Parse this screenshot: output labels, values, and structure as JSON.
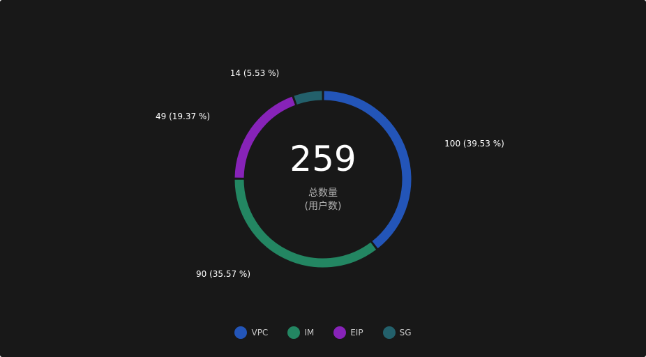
{
  "chart_data": {
    "type": "pie",
    "total": "259",
    "center_label": "总数量",
    "center_sublabel": "(用户数)",
    "categories": [
      "VPC",
      "IM",
      "EIP",
      "SG"
    ],
    "values": [
      100,
      90,
      49,
      14
    ],
    "percent_labels": [
      "100  (39.53 %)",
      "90  (35.57 %)",
      "49  (19.37 %)",
      "14  (5.53 %)"
    ],
    "colors": [
      "#2355b8",
      "#238662",
      "#8723b8",
      "#23606b"
    ],
    "legend_position": "bottom"
  }
}
